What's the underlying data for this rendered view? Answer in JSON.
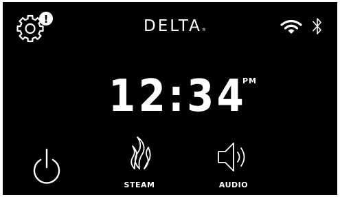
{
  "header": {
    "brand": "DELTA",
    "brand_mark": "®",
    "settings_icon": "gear-icon",
    "alert_badge": "!",
    "wifi_icon": "wifi-icon",
    "bluetooth_icon": "bluetooth-icon"
  },
  "clock": {
    "time": "12:34",
    "period": "PM"
  },
  "controls": {
    "power": {
      "icon": "power-icon"
    },
    "steam": {
      "icon": "steam-icon",
      "label": "STEAM"
    },
    "audio": {
      "icon": "speaker-icon",
      "label": "AUDIO"
    }
  },
  "colors": {
    "background": "#000000",
    "foreground": "#ffffff"
  }
}
